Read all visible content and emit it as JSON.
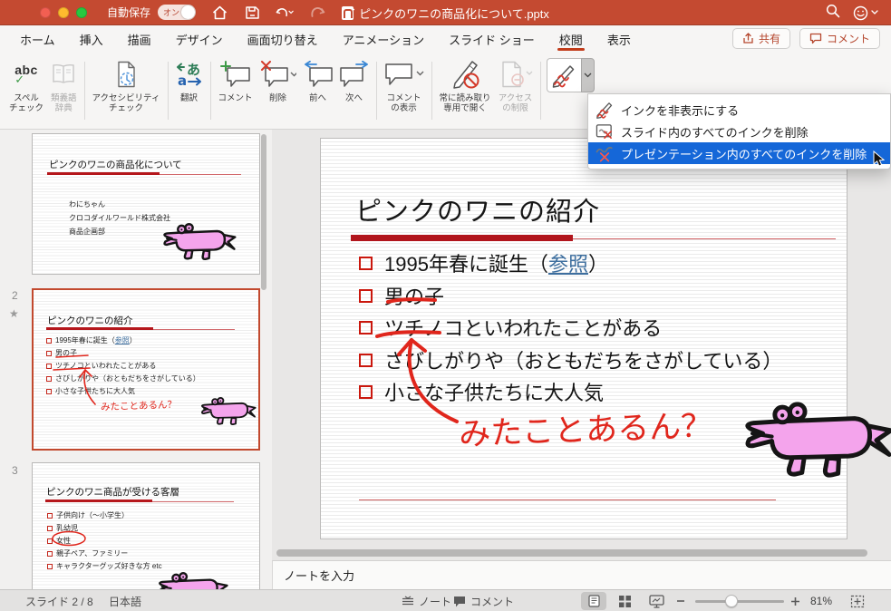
{
  "colors": {
    "titlebar_red": "#c44a31",
    "tab_accent_red": "#c23d1b",
    "menu_highlight_blue": "#1567d8",
    "ink_red": "#e0261c",
    "croc_pink": "#f4a4ec",
    "slide_rule_red": "#b2161d"
  },
  "titlebar": {
    "autosave_label": "自動保存",
    "autosave_state": "オン",
    "doc_title": "ピンクのワニの商品化について.pptx"
  },
  "tabs": [
    {
      "label": "ホーム"
    },
    {
      "label": "挿入"
    },
    {
      "label": "描画"
    },
    {
      "label": "デザイン"
    },
    {
      "label": "画面切り替え"
    },
    {
      "label": "アニメーション"
    },
    {
      "label": "スライド ショー"
    },
    {
      "label": "校閲",
      "active": true
    },
    {
      "label": "表示"
    }
  ],
  "header_actions": {
    "share": "共有",
    "comments": "コメント"
  },
  "ribbon": {
    "spell_check": "スペル\nチェック",
    "spell_abc": "abc",
    "thesaurus": "類義語\n辞典",
    "accessibility": "アクセシビリティ\nチェック",
    "translate": "翻訳",
    "new_comment": "コメント",
    "delete": "削除",
    "previous": "前へ",
    "next": "次へ",
    "show_comments": "コメント\nの表示",
    "read_only": "常に読み取り\n専用で開く",
    "restrict_access": "アクセス\nの制限"
  },
  "ink_menu": {
    "items": [
      {
        "label": "インクを非表示にする"
      },
      {
        "label": "スライド内のすべてのインクを削除"
      },
      {
        "label": "プレゼンテーション内のすべてのインクを削除",
        "highlighted": true
      }
    ]
  },
  "sidebar": {
    "slides": [
      {
        "title": "ピンクのワニの商品化について",
        "lines": [
          "わにちゃん",
          "クロコダイルワールド株式会社",
          "商品企画部"
        ]
      },
      {
        "number": "2",
        "star": "★",
        "title": "ピンクのワニの紹介",
        "bullets": [
          "1995年春に誕生（",
          "男の子",
          "ツチノコといわれたことがある",
          "さびしがりや（おともだちをさがしている）",
          "小さな子供たちに大人気"
        ],
        "link": "参照",
        "link_suffix": "）",
        "ink_note": "みたことあるん？",
        "selected": true
      },
      {
        "number": "3",
        "title": "ピンクのワニ商品が受ける客層",
        "bullets": [
          "子供向け（～小学生）",
          "乳幼児",
          "女性",
          "親子ペア、ファミリー",
          "キャラクターグッズ好きな方 etc"
        ]
      }
    ]
  },
  "slide": {
    "title": "ピンクのワニの紹介",
    "bullet1_prefix": "1995年春に誕生（",
    "bullet1_link": "参照",
    "bullet1_suffix": "）",
    "bullet2": "男の子",
    "bullet3": "ツチノコといわれたことがある",
    "bullet4": "さびしがりや（おともだちをさがしている）",
    "bullet5": "小さな子供たちに大人気",
    "ink_note": "みたことあるん？"
  },
  "notes": {
    "placeholder": "ノートを入力"
  },
  "statusbar": {
    "slide_counter": "スライド 2 / 8",
    "language": "日本語",
    "notes_label": "ノート",
    "comments_label": "コメント",
    "zoom_level": "81%"
  }
}
